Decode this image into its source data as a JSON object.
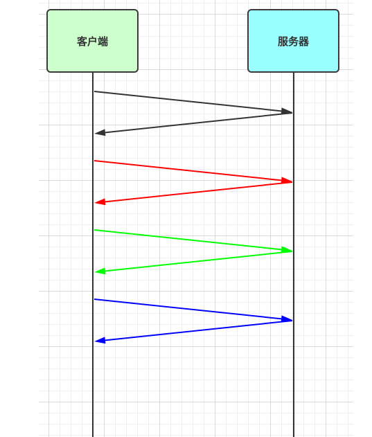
{
  "participants": [
    {
      "label": "客户端",
      "fill": "#ccffcc"
    },
    {
      "label": "服务器",
      "fill": "#99ffff"
    }
  ],
  "lifeline_color": "#333333",
  "messages": [
    {
      "from": 0,
      "to": 1,
      "color": "#333333"
    },
    {
      "from": 1,
      "to": 0,
      "color": "#333333"
    },
    {
      "from": 0,
      "to": 1,
      "color": "#ff0000"
    },
    {
      "from": 1,
      "to": 0,
      "color": "#ff0000"
    },
    {
      "from": 0,
      "to": 1,
      "color": "#00ff00"
    },
    {
      "from": 1,
      "to": 0,
      "color": "#00ff00"
    },
    {
      "from": 0,
      "to": 1,
      "color": "#0000ff"
    },
    {
      "from": 1,
      "to": 0,
      "color": "#0000ff"
    }
  ]
}
